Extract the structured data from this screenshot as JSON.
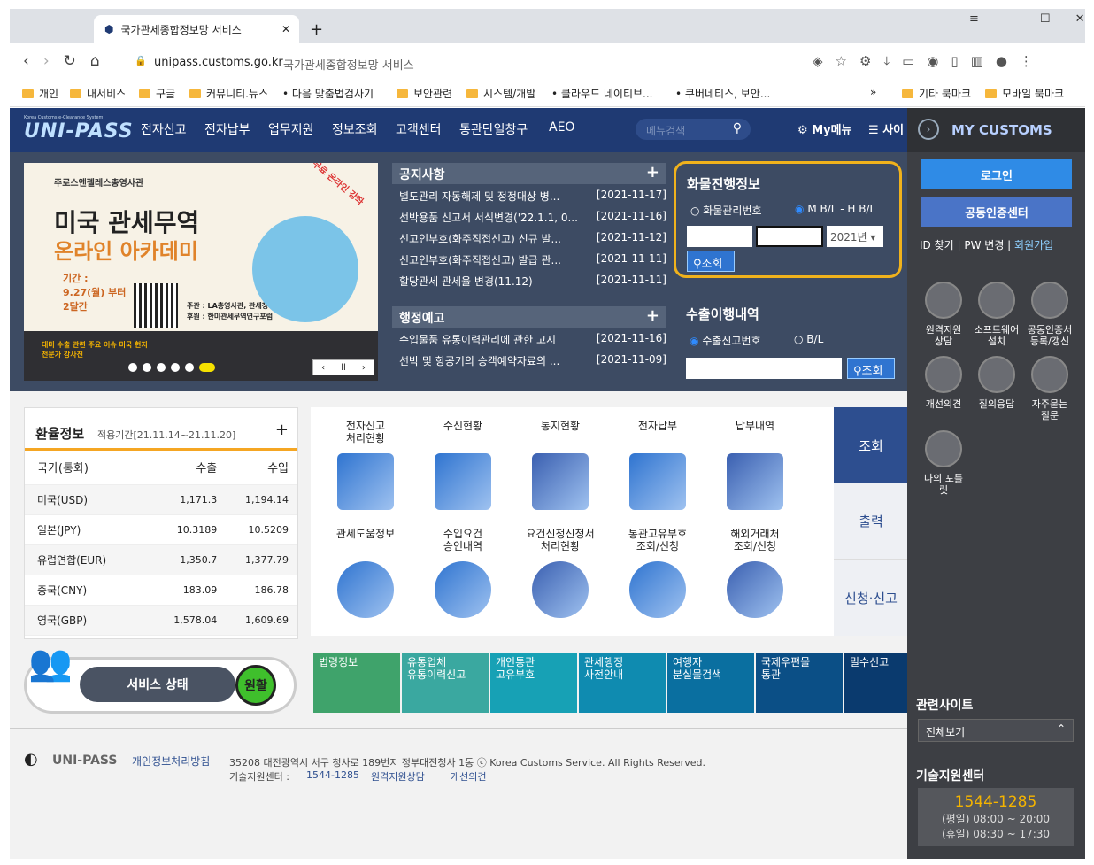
{
  "browser": {
    "tab_title": "국가관세종합정보망 서비스",
    "url": "unipass.customs.go.kr",
    "page_title": "국가관세종합정보망 서비스",
    "bookmarks": [
      "개인",
      "내서비스",
      "구글",
      "커뮤니티.뉴스",
      "다음 맞춤법검사기",
      "보안관련",
      "시스템/개발",
      "클라우드 네이티브...",
      "쿠버네티스, 보안...",
      "»",
      "기타 북마크",
      "모바일 북마크"
    ]
  },
  "nav": {
    "logo": "UNI-PASS",
    "logo_sub": "Korea Customs e-Clearance System",
    "items": [
      "전자신고",
      "전자납부",
      "업무지원",
      "정보조회",
      "고객센터",
      "통관단일창구",
      "AEO"
    ],
    "search_placeholder": "메뉴검색",
    "mymenu": "My메뉴",
    "sitemap": "사이"
  },
  "banner": {
    "org": "주로스앤젤레스총영사관",
    "title1": "미국 관세무역",
    "title2": "온라인 아카데미",
    "period": "기간 : 9.27(월) 부터 2달간",
    "tag": "무료 온라인 강좌",
    "host1": "주관 : LA총영사관, 관세청",
    "host2": "후원 : 한미관세무역연구포럼",
    "foot": "대미 수출 관련 주요 이슈 미국 현지 전문가 강사진"
  },
  "notice": {
    "title": "공지사항",
    "plus": "+",
    "items": [
      {
        "t": "별도관리 자동해제 및 정정대상 병...",
        "d": "[2021-11-17]"
      },
      {
        "t": "선박용품 신고서 서식변경('22.1.1, 0...",
        "d": "[2021-11-16]"
      },
      {
        "t": "신고인부호(화주직접신고) 신규 발...",
        "d": "[2021-11-12]"
      },
      {
        "t": "신고인부호(화주직접신고) 발급 관...",
        "d": "[2021-11-11]"
      },
      {
        "t": "할당관세 관세율 변경(11.12)",
        "d": "[2021-11-11]"
      }
    ]
  },
  "admin": {
    "title": "행정예고",
    "plus": "+",
    "items": [
      {
        "t": "수입물품 유통이력관리에 관한 고시",
        "d": "[2021-11-16]"
      },
      {
        "t": "선박 및 항공기의 승객예약자료의 ...",
        "d": "[2021-11-09]"
      }
    ]
  },
  "cargo": {
    "title": "화물진행정보",
    "opt1": "화물관리번호",
    "opt2": "M B/L - H B/L",
    "year": "2021년",
    "search": "조회"
  },
  "export": {
    "title": "수출이행내역",
    "opt1": "수출신고번호",
    "opt2": "B/L",
    "search": "조회"
  },
  "rates": {
    "title": "환율정보",
    "period": "적용기간[21.11.14~21.11.20]",
    "plus": "+",
    "head": [
      "국가(통화)",
      "수출",
      "수입"
    ],
    "rows": [
      [
        "미국(USD)",
        "1,171.3",
        "1,194.14"
      ],
      [
        "일본(JPY)",
        "10.3189",
        "10.5209"
      ],
      [
        "유럽연합(EUR)",
        "1,350.7",
        "1,377.79"
      ],
      [
        "중국(CNY)",
        "183.09",
        "186.78"
      ],
      [
        "영국(GBP)",
        "1,578.04",
        "1,609.69"
      ]
    ]
  },
  "status": {
    "label": "서비스 상태",
    "value": "원활"
  },
  "services": {
    "row1": [
      "전자신고\n처리현황",
      "수신현황",
      "통지현황",
      "전자납부",
      "납부내역"
    ],
    "row2": [
      "관세도움정보",
      "수입요건\n승인내역",
      "요건신청신청서\n처리현황",
      "통관고유부호\n조회/신청",
      "해외거래처\n조회/신청"
    ],
    "tabs": [
      "조회",
      "출력",
      "신청·신고"
    ]
  },
  "bottom": [
    "법령정보",
    "유통업체\n유통이력신고",
    "개인통관\n고유부호",
    "관세행정\n사전안내",
    "여행자\n분실물검색",
    "국제우편물\n통관",
    "밀수신고"
  ],
  "footer": {
    "brand": "UNI-PASS",
    "privacy": "개인정보처리방침",
    "address": "35208 대전광역시 서구 청사로 189번지 정부대전청사 1동 ⓒ Korea Customs Service. All Rights Reserved.",
    "tech": "기술지원센터 :",
    "phone": "1544-1285",
    "remote": "원격지원상담",
    "improve": "개선의견"
  },
  "side": {
    "title": "MY CUSTOMS",
    "login": "로그인",
    "cert": "공동인증센터",
    "id": "ID 찾기",
    "pw": "PW 변경",
    "join": "회원가입",
    "icons": [
      "원격지원\n상담",
      "소프트웨어\n설치",
      "공동인증서\n등록/갱신",
      "개선의견",
      "질의응답",
      "자주묻는\n질문",
      "나의 포틀\n릿"
    ],
    "related": "관련사이트",
    "related_sel": "전체보기",
    "tech": "기술지원센터",
    "phone": "1544-1285",
    "hours1": "(평일) 08:00 ~ 20:00",
    "hours2": "(휴일) 08:30 ~ 17:30"
  },
  "colors": {
    "nav": "#1f3a73",
    "side": "#3d3f44",
    "blue": "#2f74d0",
    "accent": "#f5b400"
  }
}
